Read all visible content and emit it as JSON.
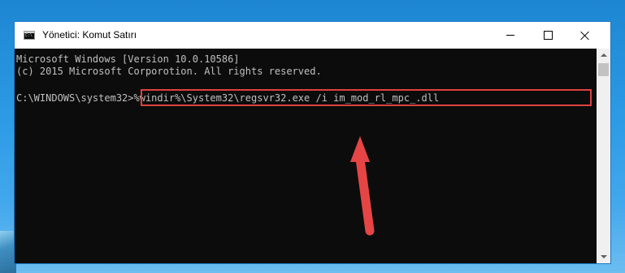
{
  "window": {
    "title": "Yönetici: Komut Satırı"
  },
  "console": {
    "lines": [
      "Microsoft Windows [Version 10.0.10586]",
      "(c) 2015 Microsoft Corporotion. All rights reserved."
    ],
    "prompt": "C:\\WINDOWS\\system32>",
    "command": "%windir%\\System32\\regsvr32.exe /i im_mod_rl_mpc_.dll"
  },
  "colors": {
    "highlight": "#e04040",
    "arrow": "#e64545",
    "console_bg": "#0c0c0c",
    "console_text": "#c0c0c0"
  },
  "icons": {
    "app": "cmd-icon",
    "minimize": "minimize-icon",
    "maximize": "maximize-icon",
    "close": "close-icon",
    "pointer": "red-arrow-icon"
  }
}
